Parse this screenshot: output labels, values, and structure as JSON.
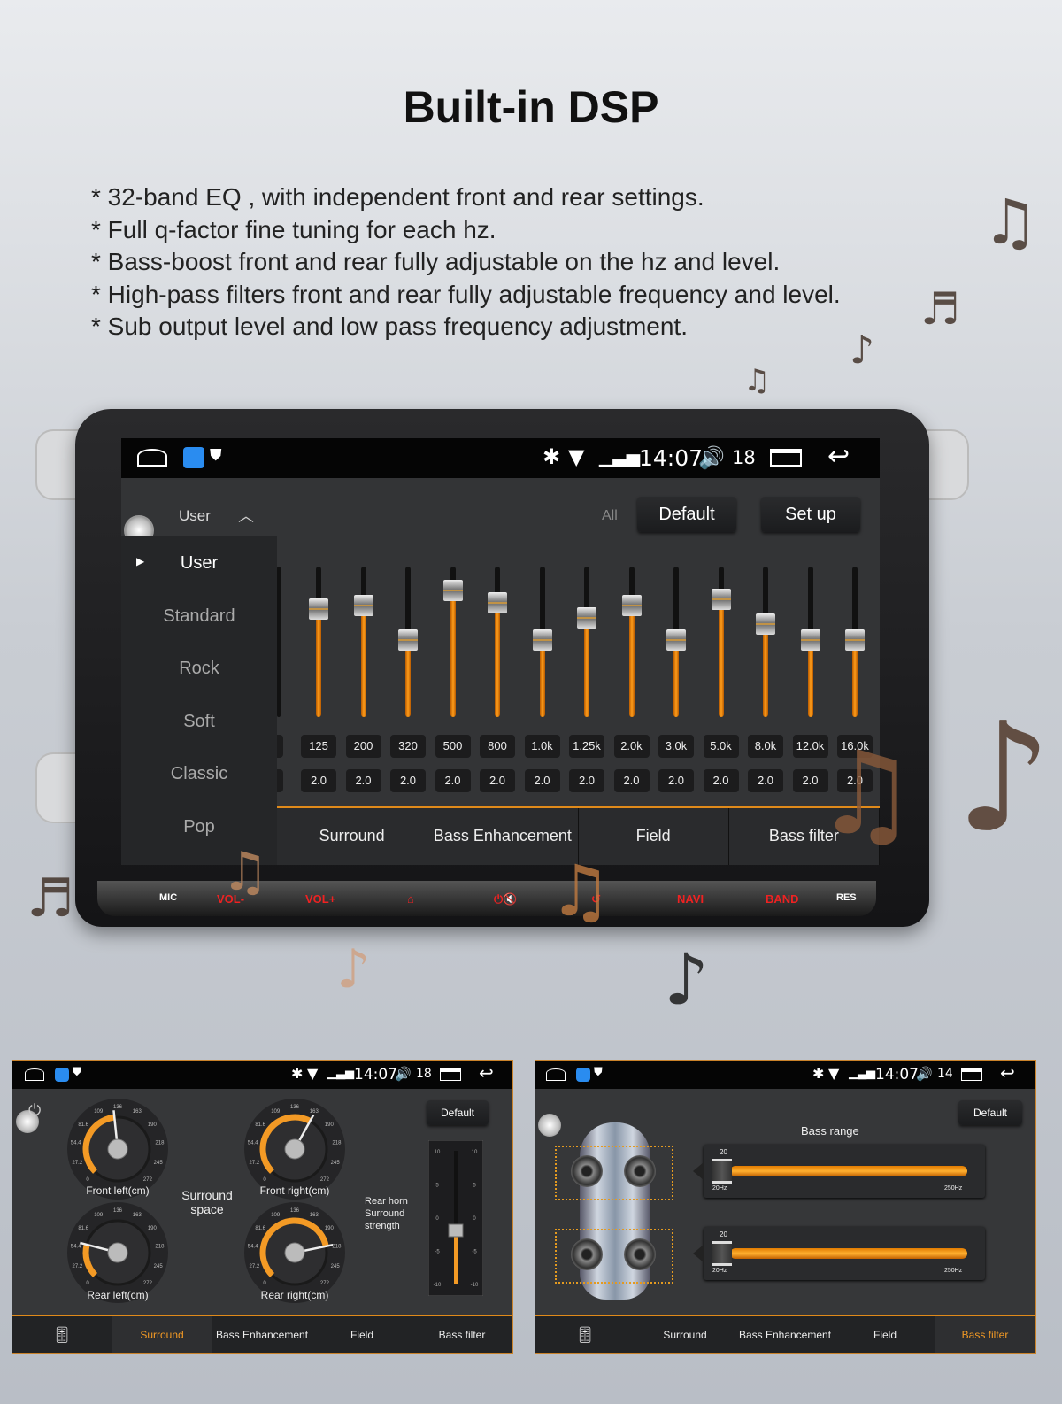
{
  "title": "Built-in DSP",
  "bullets": [
    "* 32-band EQ , with independent front and rear settings.",
    "* Full q-factor fine tuning for each hz.",
    "* Bass-boost front and rear fully adjustable on the hz and level.",
    "* High-pass filters front and rear fully adjustable frequency and level.",
    "* Sub output level and  low pass frequency adjustment."
  ],
  "colors": {
    "accent": "#f39a25",
    "panel": "#333436",
    "statusbar": "#050505",
    "hardware_label": "#e22222"
  },
  "status": {
    "time": "14:07",
    "volume": "18",
    "volume_right_panel": "14",
    "icons": [
      "home-icon",
      "app-icon",
      "shield-icon",
      "bluetooth-icon",
      "wifi-icon",
      "signal-icon",
      "volume-icon",
      "recent-apps-icon",
      "back-icon"
    ]
  },
  "eq": {
    "preset_selected": "User",
    "all_label": "All",
    "default_label": "Default",
    "setup_label": "Set up",
    "presets": [
      "User",
      "Standard",
      "Rock",
      "Soft",
      "Classic",
      "Pop"
    ],
    "bands": [
      {
        "freq": "125",
        "q": "2.0",
        "level": 0.72
      },
      {
        "freq": "200",
        "q": "2.0",
        "level": 0.74
      },
      {
        "freq": "320",
        "q": "2.0",
        "level": 0.51
      },
      {
        "freq": "500",
        "q": "2.0",
        "level": 0.84
      },
      {
        "freq": "800",
        "q": "2.0",
        "level": 0.76
      },
      {
        "freq": "1.0k",
        "q": "2.0",
        "level": 0.51
      },
      {
        "freq": "1.25k",
        "q": "2.0",
        "level": 0.66
      },
      {
        "freq": "2.0k",
        "q": "2.0",
        "level": 0.74
      },
      {
        "freq": "3.0k",
        "q": "2.0",
        "level": 0.51
      },
      {
        "freq": "5.0k",
        "q": "2.0",
        "level": 0.78
      },
      {
        "freq": "8.0k",
        "q": "2.0",
        "level": 0.62
      },
      {
        "freq": "12.0k",
        "q": "2.0",
        "level": 0.51
      },
      {
        "freq": "16.0k",
        "q": "2.0",
        "level": 0.51
      }
    ]
  },
  "tabs": [
    "Surround",
    "Bass Enhancement",
    "Field",
    "Bass filter"
  ],
  "hardware_buttons": [
    "MIC",
    "VOL-",
    "VOL+",
    "⌂",
    "⏻🔇",
    "↺",
    "NAVI",
    "BAND",
    "RES"
  ],
  "surround": {
    "title": "Surround space",
    "default_label": "Default",
    "gauge_ticks": [
      "0",
      "27.2",
      "54.4",
      "81.6",
      "109",
      "136",
      "163",
      "190",
      "218",
      "245",
      "272"
    ],
    "gauges": [
      {
        "label": "Front left(cm)",
        "value": 130
      },
      {
        "label": "Front right(cm)",
        "value": 165
      },
      {
        "label": "Rear left(cm)",
        "value": 60
      },
      {
        "label": "Rear right(cm)",
        "value": 215
      }
    ],
    "rear_label": [
      "Rear horn",
      "Surround",
      "strength"
    ],
    "strength_ticks": [
      "10",
      "5",
      "0",
      "-5",
      "-10"
    ],
    "strength_value": -2
  },
  "bass_filter": {
    "title": "Bass range",
    "default_label": "Default",
    "sliders": [
      {
        "value": "20",
        "min": "20Hz",
        "max": "250Hz"
      },
      {
        "value": "20",
        "min": "20Hz",
        "max": "250Hz"
      }
    ]
  }
}
